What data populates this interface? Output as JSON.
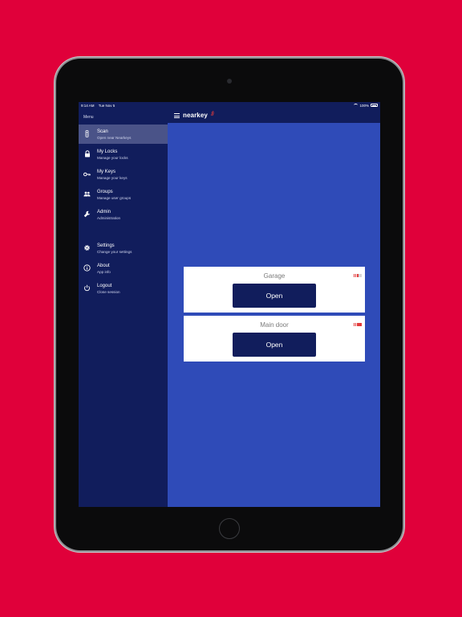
{
  "status_bar": {
    "time": "9:14 AM",
    "date": "Tue Nov 5",
    "battery": "100%"
  },
  "header": {
    "brand": "nearkey"
  },
  "sidebar": {
    "title": "Menu",
    "items": [
      {
        "label": "Scan",
        "sub": "Open near Nearkeys",
        "icon": "scan-icon",
        "active": true
      },
      {
        "label": "My Locks",
        "sub": "Manage your locks",
        "icon": "lock-icon"
      },
      {
        "label": "My Keys",
        "sub": "Manage your keys",
        "icon": "key-icon"
      },
      {
        "label": "Groups",
        "sub": "Manage user groups",
        "icon": "group-icon"
      },
      {
        "label": "Admin",
        "sub": "Administration",
        "icon": "wrench-icon"
      },
      {
        "label": "Settings",
        "sub": "Change your settings",
        "icon": "gear-icon"
      },
      {
        "label": "About",
        "sub": "App info",
        "icon": "info-icon"
      },
      {
        "label": "Logout",
        "sub": "Close session",
        "icon": "power-icon"
      }
    ]
  },
  "doors": [
    {
      "name": "Garage",
      "button": "Open",
      "signal_level": 3,
      "signal_max": 5
    },
    {
      "name": "Main door",
      "button": "Open",
      "signal_level": 5,
      "signal_max": 5
    }
  ],
  "colors": {
    "background": "#e0003a",
    "nav": "#111d5c",
    "content": "#2f4bb8",
    "signal_on": "#e23a3a"
  }
}
